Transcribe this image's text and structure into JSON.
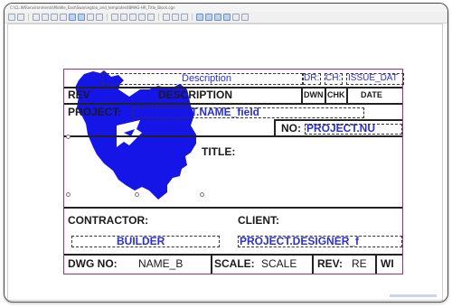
{
  "window": {
    "title": "C:\\CL.WS\\environments\\Middle_East\\Swanington_and_templates\\IBMAG-HR_Title_Block.cgn"
  },
  "titleblock": {
    "description_field": "Description",
    "dr": "DR:",
    "ch": "CH:",
    "issue_date": "ISSUE_DAT",
    "rev": "REV",
    "description": "DESCRIPTION",
    "dwn": "DWN",
    "chk": "CHK",
    "date": "DATE",
    "project_label": "PROJECT:",
    "project_field": "T.NAME_field",
    "no_label": "NO:",
    "project_number": "PROJECT.NU",
    "title_label": "TITLE:",
    "contractor_label": "CONTRACTOR:",
    "client_label": "CLIENT:",
    "builder": "BUILDER",
    "designer": "PROJECT.DESIGNER_f",
    "dwg_no_label": "DWG NO:",
    "dwg_no_value": "NAME_B",
    "scale_label": "SCALE:",
    "scale_value": "SCALE",
    "rev_label": "REV:",
    "rev_value": "RE",
    "wi": "WI"
  },
  "colors": {
    "map_fill": "#1515e8",
    "field_text": "#2a2fd0",
    "sheet_border": "#9b2f8a"
  },
  "icons": {
    "map_logo": "iran-map-logo"
  }
}
